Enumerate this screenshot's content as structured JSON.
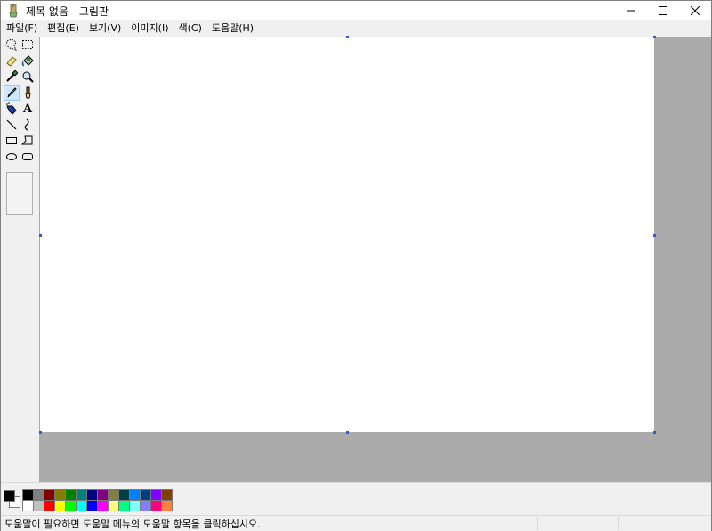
{
  "window": {
    "title": "제목 없음 - 그림판"
  },
  "menu": [
    {
      "label": "파일(F)"
    },
    {
      "label": "편집(E)"
    },
    {
      "label": "보기(V)"
    },
    {
      "label": "이미지(I)"
    },
    {
      "label": "색(C)"
    },
    {
      "label": "도움말(H)"
    }
  ],
  "tools": [
    {
      "icon": "free-form-select-icon"
    },
    {
      "icon": "rect-select-icon"
    },
    {
      "icon": "eraser-icon"
    },
    {
      "icon": "fill-bucket-icon"
    },
    {
      "icon": "color-picker-icon"
    },
    {
      "icon": "magnifier-icon"
    },
    {
      "icon": "pencil-icon",
      "selected": true
    },
    {
      "icon": "brush-icon"
    },
    {
      "icon": "airbrush-icon"
    },
    {
      "icon": "text-icon",
      "glyph": "A"
    },
    {
      "icon": "line-icon"
    },
    {
      "icon": "curve-icon"
    },
    {
      "icon": "rectangle-icon"
    },
    {
      "icon": "polygon-icon"
    },
    {
      "icon": "ellipse-icon"
    },
    {
      "icon": "rounded-rectangle-icon"
    }
  ],
  "colors": {
    "foreground": "#000000",
    "background": "#ffffff",
    "palette_top": [
      "#000000",
      "#808080",
      "#800000",
      "#808000",
      "#008000",
      "#008080",
      "#000080",
      "#800080",
      "#808040",
      "#004040",
      "#0080ff",
      "#004080",
      "#8000ff",
      "#804000"
    ],
    "palette_bottom": [
      "#ffffff",
      "#c0c0c0",
      "#ff0000",
      "#ffff00",
      "#00ff00",
      "#00ffff",
      "#0000ff",
      "#ff00ff",
      "#ffff80",
      "#00ff80",
      "#80ffff",
      "#8080ff",
      "#ff0080",
      "#ff8040"
    ]
  },
  "status": {
    "text": "도움말이 필요하면 도움말 메뉴의 도움말 항목을 클릭하십시오."
  }
}
